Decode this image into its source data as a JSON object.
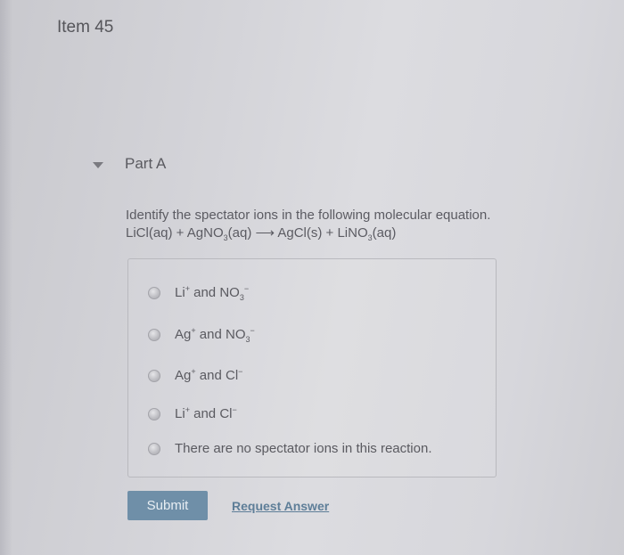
{
  "item": {
    "title": "Item 45"
  },
  "part": {
    "label": "Part A",
    "expand_icon": "caret-down-icon"
  },
  "question": {
    "prompt": "Identify the spectator ions in the following molecular equation.",
    "equation_lhs1": "LiCl(aq) + AgNO",
    "equation_sub1": "3",
    "equation_mid": "(aq) ⟶ AgCl(s) + LiNO",
    "equation_sub2": "3",
    "equation_end": "(aq)"
  },
  "options": [
    {
      "a": "Li",
      "a_sup": "+",
      "join": " and NO",
      "b_sub": "3",
      "b_sup": "−"
    },
    {
      "a": "Ag",
      "a_sup": "+",
      "join": " and NO",
      "b_sub": "3",
      "b_sup": "−"
    },
    {
      "a": "Ag",
      "a_sup": "+",
      "join": " and Cl",
      "b_sub": "",
      "b_sup": "−"
    },
    {
      "a": "Li",
      "a_sup": "+",
      "join": " and Cl",
      "b_sub": "",
      "b_sup": "−"
    },
    {
      "text": "There are no spectator ions in this reaction."
    }
  ],
  "actions": {
    "submit_label": "Submit",
    "request_answer_label": "Request Answer"
  },
  "colors": {
    "submit_bg": "#6f8fa8",
    "link": "#5e7e98"
  }
}
